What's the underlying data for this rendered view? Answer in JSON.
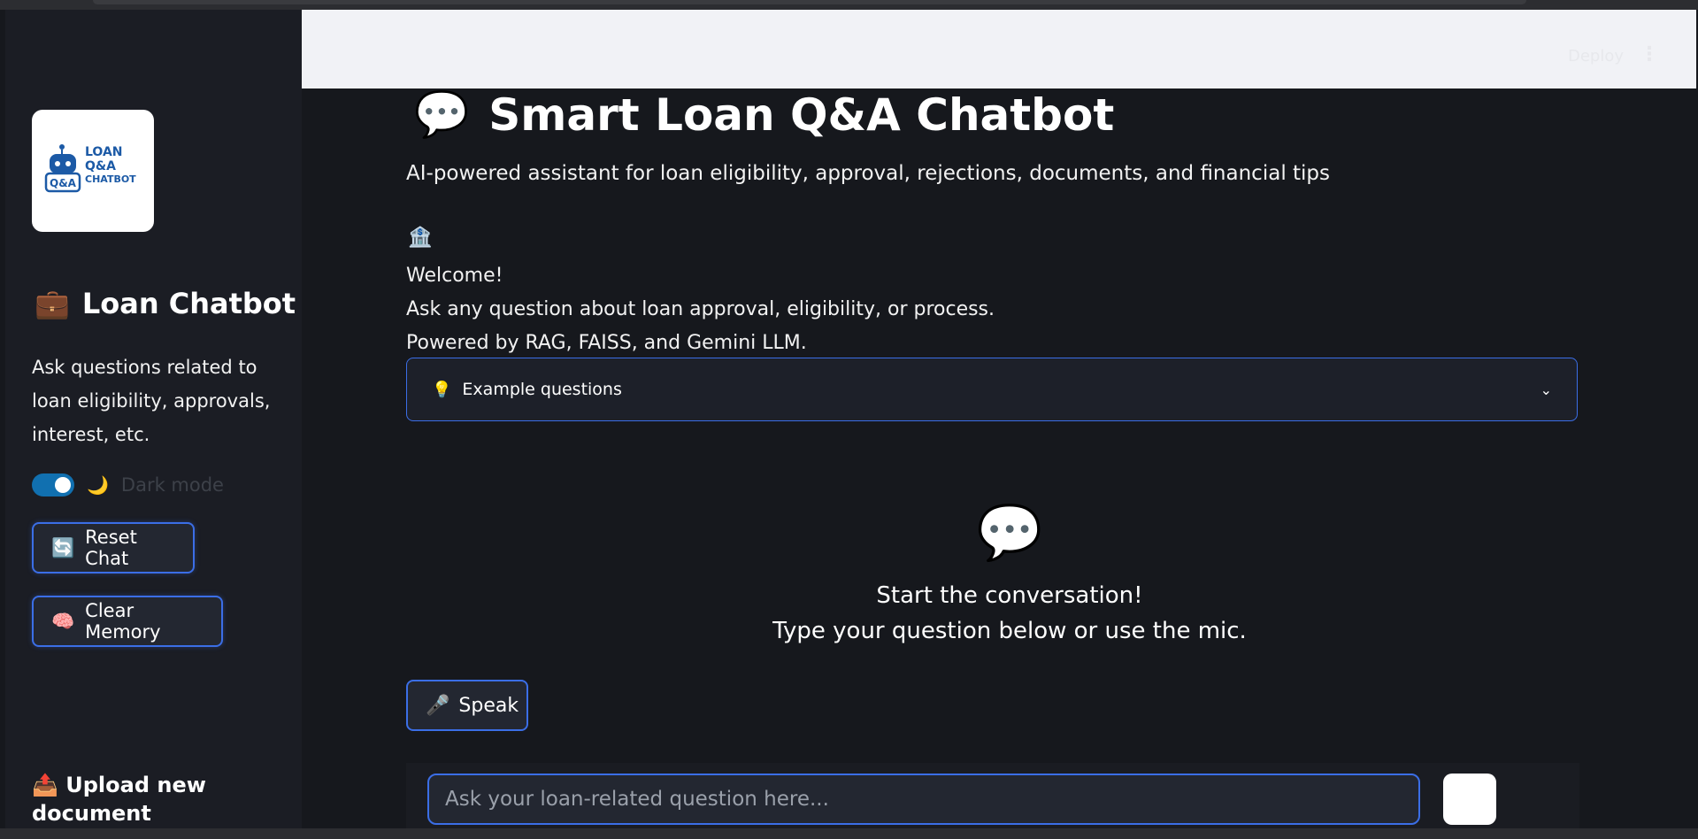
{
  "header": {
    "deploy_label": "Deploy",
    "menu_icon": "kebab-menu-icon"
  },
  "sidebar": {
    "logo": {
      "line1": "LOAN",
      "line2": "Q&A",
      "line3": "CHATBOT",
      "badge": "Q&A",
      "icon": "robot-icon"
    },
    "title_icon": "💼",
    "title": "Loan Chatbot",
    "description": "Ask questions related to loan eligibility, approvals, interest, etc.",
    "dark_mode": {
      "icon": "🌙",
      "label": "Dark mode",
      "enabled": true
    },
    "reset_button": {
      "icon": "🔄",
      "label": "Reset Chat"
    },
    "clear_button": {
      "icon": "🧠",
      "label": "Clear Memory"
    },
    "upload": {
      "icon": "📤",
      "title": "Upload new document"
    }
  },
  "main": {
    "title_icon": "💬",
    "title": "Smart Loan Q&A Chatbot",
    "subtitle": "AI-powered assistant for loan eligibility, approval, rejections, documents, and financial tips",
    "bank_icon": "🏦",
    "welcome": "Welcome!",
    "welcome_line2": "Ask any question about loan approval, eligibility, or process.",
    "welcome_line3": "Powered by RAG, FAISS, and Gemini LLM.",
    "expander": {
      "icon": "💡",
      "label": "Example questions"
    },
    "empty_state": {
      "icon": "💬",
      "line1": "Start the conversation!",
      "line2": "Type your question below or use the mic."
    },
    "speak_button": {
      "icon": "🎤",
      "label": "Speak"
    },
    "chat_input": {
      "placeholder": "Ask your loan-related question here...",
      "value": ""
    }
  },
  "colors": {
    "accent": "#3b6ee6",
    "background": "#16181d",
    "sidebar": "#1b1d24",
    "header": "#f1f2f6"
  }
}
